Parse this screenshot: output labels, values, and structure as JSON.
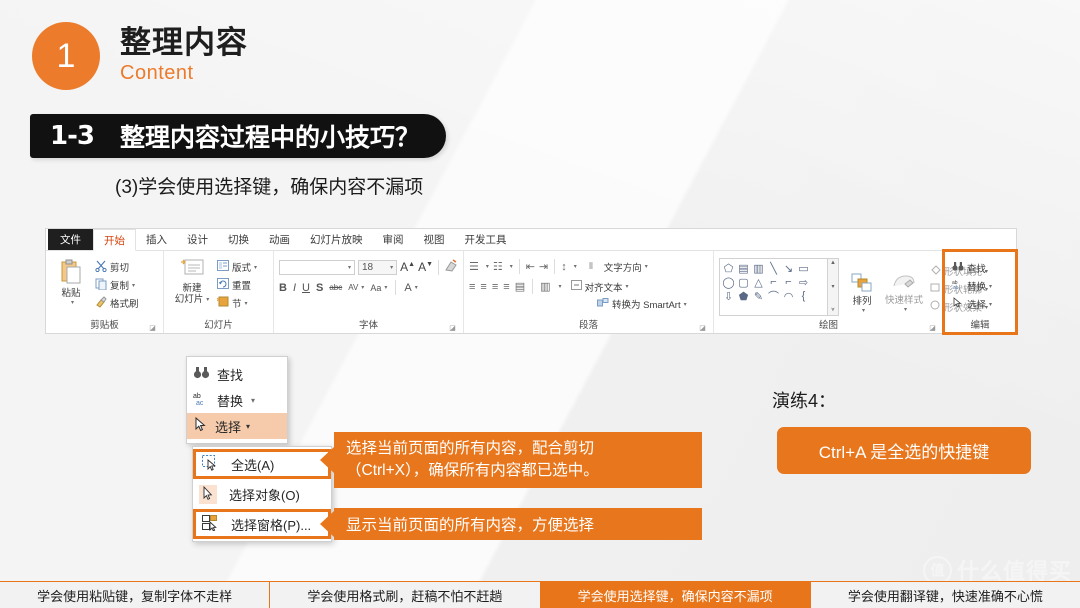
{
  "header": {
    "number": "1",
    "title_cn": "整理内容",
    "title_en": "Content"
  },
  "banner": {
    "number": "1-3",
    "title": "整理内容过程中的小技巧？"
  },
  "subtitle": "(3)学会使用选择键，确保内容不漏项",
  "ppt": {
    "tabs": [
      {
        "label": "文件",
        "state": "file"
      },
      {
        "label": "开始",
        "state": "active"
      },
      {
        "label": "插入",
        "state": "normal"
      },
      {
        "label": "设计",
        "state": "normal"
      },
      {
        "label": "切换",
        "state": "normal"
      },
      {
        "label": "动画",
        "state": "normal"
      },
      {
        "label": "幻灯片放映",
        "state": "normal"
      },
      {
        "label": "审阅",
        "state": "normal"
      },
      {
        "label": "视图",
        "state": "normal"
      },
      {
        "label": "开发工具",
        "state": "normal"
      }
    ],
    "clipboard": {
      "label": "剪贴板",
      "paste": "粘贴",
      "cut": "剪切",
      "copy": "复制",
      "format_painter": "格式刷"
    },
    "slides": {
      "label": "幻灯片",
      "new_slide_line1": "新建",
      "new_slide_line2": "幻灯片",
      "layout": "版式",
      "reset": "重置",
      "section": "节"
    },
    "font": {
      "label": "字体",
      "font_name": "",
      "font_size": "18",
      "grow": "A",
      "shrink": "A",
      "bold": "B",
      "italic": "I",
      "underline": "U",
      "shadow": "S",
      "strike": "abc",
      "spacing": "AV",
      "case": "Aa",
      "color": "A"
    },
    "paragraph": {
      "label": "段落",
      "text_direction": "文字方向",
      "align_text": "对齐文本",
      "smartart": "转换为 SmartArt"
    },
    "drawing": {
      "label": "绘图",
      "arrange": "排列",
      "quick_styles": "快速样式",
      "shape_fill": "形状填充",
      "shape_outline": "形状轮廓",
      "shape_effects": "形状效果"
    },
    "editing": {
      "label": "编辑",
      "find": "查找",
      "replace": "替换",
      "select": "选择"
    }
  },
  "dropdown": {
    "find": "查找",
    "replace": "替换",
    "select": "选择",
    "submenu": [
      {
        "label": "全选(A)",
        "highlight": true
      },
      {
        "label": "选择对象(O)",
        "highlight": false
      },
      {
        "label": "选择窗格(P)...",
        "highlight": true
      }
    ]
  },
  "callouts": {
    "one_line1": "选择当前页面的所有内容，配合剪切",
    "one_line2": "（Ctrl+X），确保所有内容都已选中。",
    "two": "显示当前页面的所有内容，方便选择"
  },
  "exercise": {
    "label": "演练4：",
    "box_text": "Ctrl+A 是全选的快捷键"
  },
  "watermark": {
    "mark": "值",
    "text": "什么值得买"
  },
  "bottom_bar": [
    {
      "label": "学会使用粘贴键，复制字体不走样",
      "active": false
    },
    {
      "label": "学会使用格式刷，赶稿不怕不赶趟",
      "active": false
    },
    {
      "label": "学会使用选择键，确保内容不漏项",
      "active": true
    },
    {
      "label": "学会使用翻译键，快速准确不心慌",
      "active": false
    }
  ],
  "colors": {
    "accent_orange": "#e8761c",
    "banner_black": "#111111",
    "background": "#f2f2f2"
  }
}
